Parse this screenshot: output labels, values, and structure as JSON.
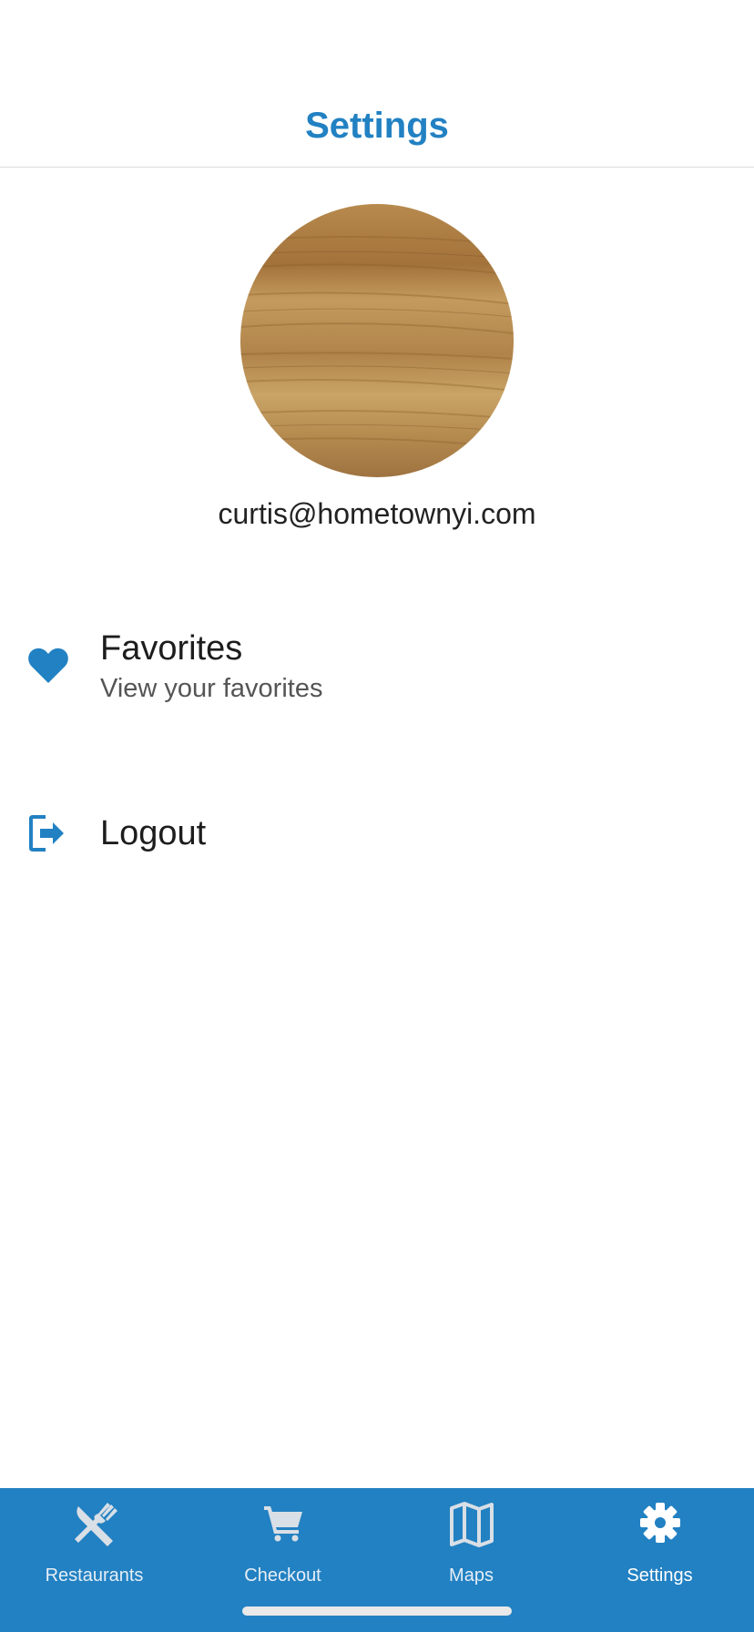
{
  "header": {
    "title": "Settings"
  },
  "profile": {
    "email": "curtis@hometownyi.com"
  },
  "menu": {
    "favorites": {
      "title": "Favorites",
      "subtitle": "View your favorites",
      "icon": "heart-icon"
    },
    "logout": {
      "title": "Logout",
      "icon": "logout-icon"
    }
  },
  "tabs": [
    {
      "label": "Restaurants",
      "icon": "fork-knife-icon"
    },
    {
      "label": "Checkout",
      "icon": "cart-icon"
    },
    {
      "label": "Maps",
      "icon": "map-icon"
    },
    {
      "label": "Settings",
      "icon": "gear-icon",
      "active": true
    }
  ],
  "colors": {
    "accent": "#2281c2",
    "tabbar": "#2281c2",
    "text": "#1d1d1d",
    "subtext": "#555555"
  }
}
